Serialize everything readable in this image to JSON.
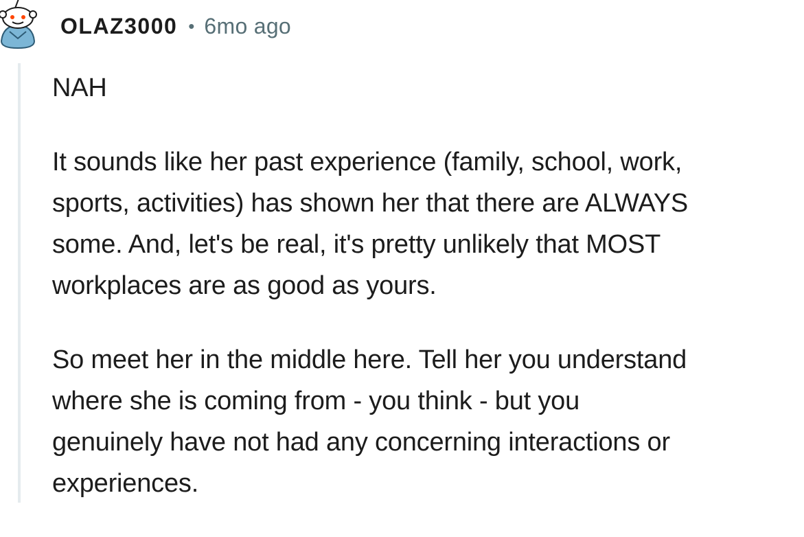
{
  "comment": {
    "username": "OLAZ3000",
    "separator": "•",
    "timestamp": "6mo ago",
    "avatar_icon": "snoo-avatar-icon",
    "paragraphs": [
      {
        "lines": [
          "NAH"
        ]
      },
      {
        "lines": [
          "It sounds like her past experience (family, school, work,",
          "sports, activities) has shown her that there are ALWAYS",
          "some. And, let's be real, it's pretty unlikely that MOST",
          "workplaces are as good as yours."
        ]
      },
      {
        "lines": [
          "So meet her in the middle here. Tell her you understand",
          "where she is coming from - you think - but you",
          "genuinely have not had any concerning interactions or",
          "experiences."
        ]
      }
    ]
  },
  "colors": {
    "text": "#1c1c1c",
    "meta": "#576f76",
    "thread_line": "#e5ebee",
    "avatar_bg": "#6fa8c9"
  }
}
